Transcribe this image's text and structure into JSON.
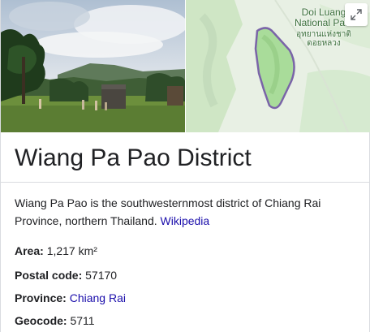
{
  "header": {
    "title": "Wiang Pa Pao District"
  },
  "media": {
    "photo_icon": "landscape-photo",
    "map": {
      "label_en_line1": "Doi Luang",
      "label_en_line2": "National Park",
      "label_th_line1": "อุทยานแห่งชาติ",
      "label_th_line2": "ดอยหลวง",
      "expand_icon": "expand-icon",
      "colors": {
        "park_green": "#a9dc9a",
        "land": "#e8f0e4",
        "boundary": "#7a64a8"
      }
    }
  },
  "description": {
    "text": "Wiang Pa Pao is the southwesternmost district of Chiang Rai Province, northern Thailand.",
    "source_link": "Wikipedia"
  },
  "facts": {
    "area_label": "Area:",
    "area_value": "1,217 km²",
    "postal_label": "Postal code:",
    "postal_value": "57170",
    "province_label": "Province:",
    "province_value": "Chiang Rai",
    "geocode_label": "Geocode:",
    "geocode_value": "5711"
  },
  "colors": {
    "link": "#1a0dab",
    "text": "#202124",
    "divider": "#dadce0"
  }
}
